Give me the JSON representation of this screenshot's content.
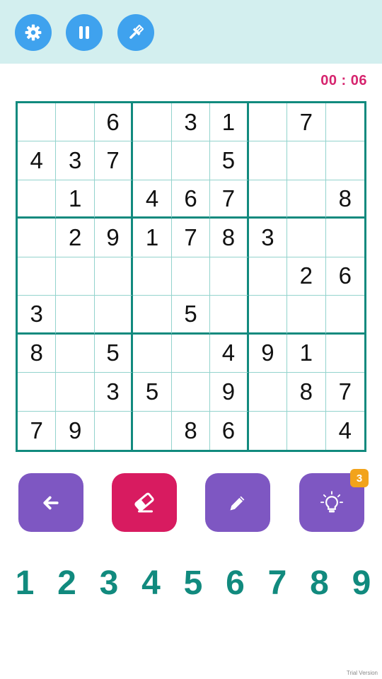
{
  "top_buttons": [
    {
      "name": "settings-button",
      "icon": "gear-icon"
    },
    {
      "name": "pause-button",
      "icon": "pause-icon"
    },
    {
      "name": "theme-button",
      "icon": "paintbrush-icon"
    }
  ],
  "timer": "00 : 06",
  "board": [
    [
      "",
      "",
      "6",
      "",
      "3",
      "1",
      "",
      "7",
      ""
    ],
    [
      "4",
      "3",
      "7",
      "",
      "",
      "5",
      "",
      "",
      ""
    ],
    [
      "",
      "1",
      "",
      "4",
      "6",
      "7",
      "",
      "",
      "8"
    ],
    [
      "",
      "2",
      "9",
      "1",
      "7",
      "8",
      "3",
      "",
      ""
    ],
    [
      "",
      "",
      "",
      "",
      "",
      "",
      "",
      "2",
      "6"
    ],
    [
      "3",
      "",
      "",
      "",
      "5",
      "",
      "",
      "",
      ""
    ],
    [
      "8",
      "",
      "5",
      "",
      "",
      "4",
      "9",
      "1",
      ""
    ],
    [
      "",
      "",
      "3",
      "5",
      "",
      "9",
      "",
      "8",
      "7"
    ],
    [
      "7",
      "9",
      "",
      "",
      "8",
      "6",
      "",
      "",
      "4"
    ]
  ],
  "tools": [
    {
      "name": "undo-button",
      "icon": "arrow-left-icon"
    },
    {
      "name": "erase-button",
      "icon": "eraser-icon"
    },
    {
      "name": "notes-button",
      "icon": "pencil-icon"
    },
    {
      "name": "hint-button",
      "icon": "lightbulb-icon",
      "badge": "3"
    }
  ],
  "numpad": [
    "1",
    "2",
    "3",
    "4",
    "5",
    "6",
    "7",
    "8",
    "9"
  ],
  "watermark": "Trial Version",
  "colors": {
    "header_bg": "#d3efef",
    "top_button": "#3fa2ee",
    "grid_major": "#118a7e",
    "grid_minor": "#93d3cd",
    "timer": "#d6246e",
    "tool_purple": "#7e57c2",
    "tool_pink": "#d81b60",
    "badge": "#f2a31b",
    "numpad": "#118a7e"
  }
}
